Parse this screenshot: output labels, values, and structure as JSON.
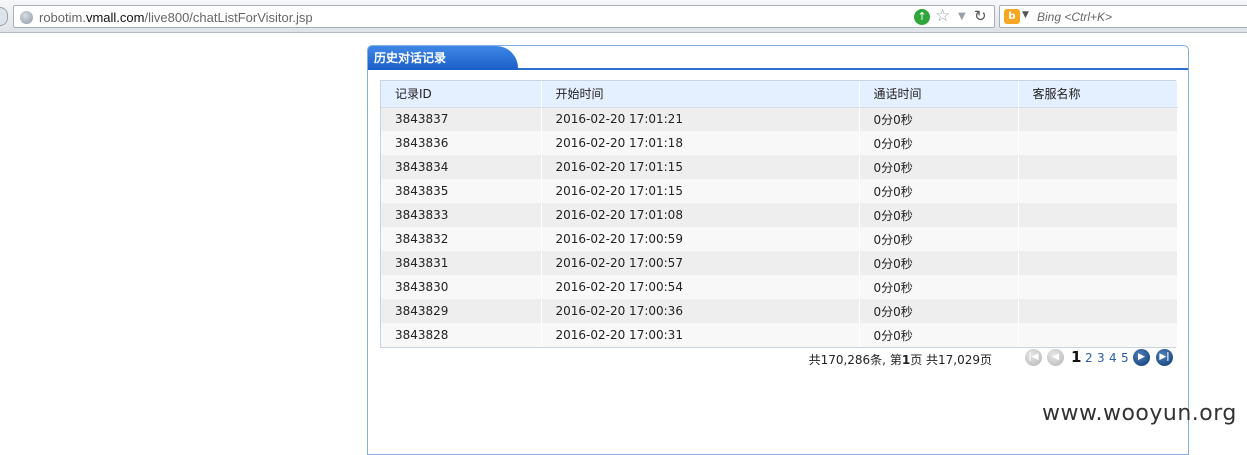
{
  "browser": {
    "url_prefix": "robotim.",
    "url_domain": "vmall.com",
    "url_path": "/live800/chatListForVisitor.jsp",
    "search_placeholder": "Bing <Ctrl+K>"
  },
  "panel": {
    "title": "历史对话记录"
  },
  "table": {
    "headers": [
      "记录ID",
      "开始时间",
      "通话时间",
      "客服名称"
    ],
    "rows": [
      [
        "3843837",
        "2016-02-20 17:01:21",
        "0分0秒",
        ""
      ],
      [
        "3843836",
        "2016-02-20 17:01:18",
        "0分0秒",
        ""
      ],
      [
        "3843834",
        "2016-02-20 17:01:15",
        "0分0秒",
        ""
      ],
      [
        "3843835",
        "2016-02-20 17:01:15",
        "0分0秒",
        ""
      ],
      [
        "3843833",
        "2016-02-20 17:01:08",
        "0分0秒",
        ""
      ],
      [
        "3843832",
        "2016-02-20 17:00:59",
        "0分0秒",
        ""
      ],
      [
        "3843831",
        "2016-02-20 17:00:57",
        "0分0秒",
        ""
      ],
      [
        "3843830",
        "2016-02-20 17:00:54",
        "0分0秒",
        ""
      ],
      [
        "3843829",
        "2016-02-20 17:00:36",
        "0分0秒",
        ""
      ],
      [
        "3843828",
        "2016-02-20 17:00:31",
        "0分0秒",
        ""
      ]
    ]
  },
  "pager": {
    "summary_prefix": "共170,286条, 第",
    "current_page": "1",
    "summary_suffix": "页 共17,029页",
    "page_links": [
      "2",
      "3",
      "4",
      "5"
    ]
  },
  "watermark": "www.wooyun.org"
}
